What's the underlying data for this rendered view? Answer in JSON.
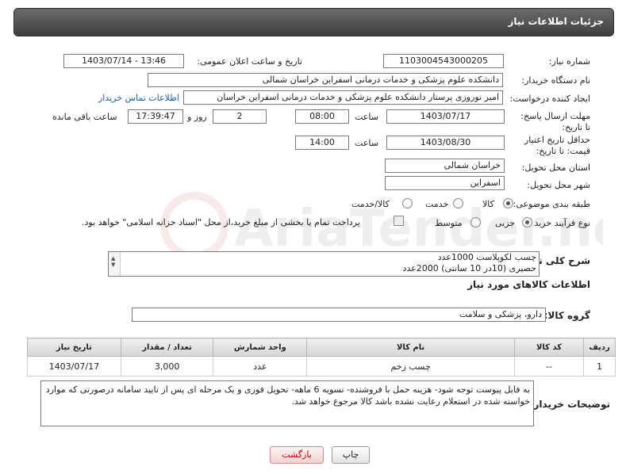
{
  "header": {
    "title": "جزئیات اطلاعات نیاز"
  },
  "fields": {
    "need_number": {
      "label": "شماره نیاز:",
      "value": "1103004543000205"
    },
    "announce": {
      "label": "تاریخ و ساعت اعلان عمومی:",
      "value": "1403/07/14 - 13:46"
    },
    "buyer_org": {
      "label": "نام دستگاه خریدار:",
      "value": "دانشکده علوم پزشکی و خدمات درمانی اسفراین خراسان شمالی"
    },
    "requester": {
      "label": "ایجاد کننده درخواست:",
      "value": "امیر  نوروزی  پرستار  دانشکده علوم پزشکی و خدمات درمانی اسفراین خراسان",
      "link": "اطلاعات تماس خریدار"
    },
    "deadline": {
      "label": "مهلت ارسال پاسخ: تا تاریخ:",
      "date": "1403/07/17",
      "time_label": "ساعت",
      "time": "08:00",
      "days": "2",
      "days_label": "روز و",
      "remaining": "17:39:47",
      "remaining_label": "ساعت باقی مانده"
    },
    "validity": {
      "label": "حداقل تاریخ اعتبار قیمت: تا تاریخ:",
      "date": "1403/08/30",
      "time_label": "ساعت",
      "time": "14:00"
    },
    "province": {
      "label": "استان محل تحویل:",
      "value": "خراسان شمالی"
    },
    "city": {
      "label": "شهر محل تحویل:",
      "value": "اسفراین"
    },
    "category": {
      "label": "طبقه بندی موضوعی:",
      "options": [
        "کالا",
        "خدمت",
        "کالا/خدمت"
      ],
      "selected": "کالا"
    },
    "process": {
      "label": "نوع فرآیند خرید :",
      "options": [
        "جزیی",
        "متوسط"
      ],
      "selected": "جزیی",
      "payment_note": "پرداخت تمام یا بخشی از مبلغ خرید،از محل \"اسناد خزانه اسلامی\" خواهد بود."
    }
  },
  "need_summary": {
    "label": "شرح کلی نیاز:",
    "lines": [
      "چسب لکوپلاست 1000عدد",
      "حصیری (10در 10 سانتی) 2000عدد"
    ]
  },
  "goods_section": {
    "title": "اطلاعات کالاهای مورد نیاز"
  },
  "goods_group": {
    "label": "گروه کالا:",
    "value": "دارو، پزشکی و سلامت"
  },
  "table": {
    "headers": [
      "ردیف",
      "کد کالا",
      "نام کالا",
      "واحد شمارش",
      "تعداد / مقدار",
      "تاریخ نیاز"
    ],
    "rows": [
      [
        "1",
        "--",
        "چسب زخم",
        "عدد",
        "3,000",
        "1403/07/17"
      ]
    ]
  },
  "buyer_notes": {
    "label": "توضیحات خریدار:",
    "text": "به فایل پیوست توجه شود- هزینه حمل با فروشنده- تسویه 6 ماهه- تحویل فوری و یک مرحله ای پس از تایید سامانه درصورتی که موارد خواسته شده در استعلام رعایت نشده باشد کالا مرجوع خواهد شد."
  },
  "buttons": {
    "print": "چاپ",
    "back": "بازگشت"
  },
  "watermark": "AriaTender.neT"
}
